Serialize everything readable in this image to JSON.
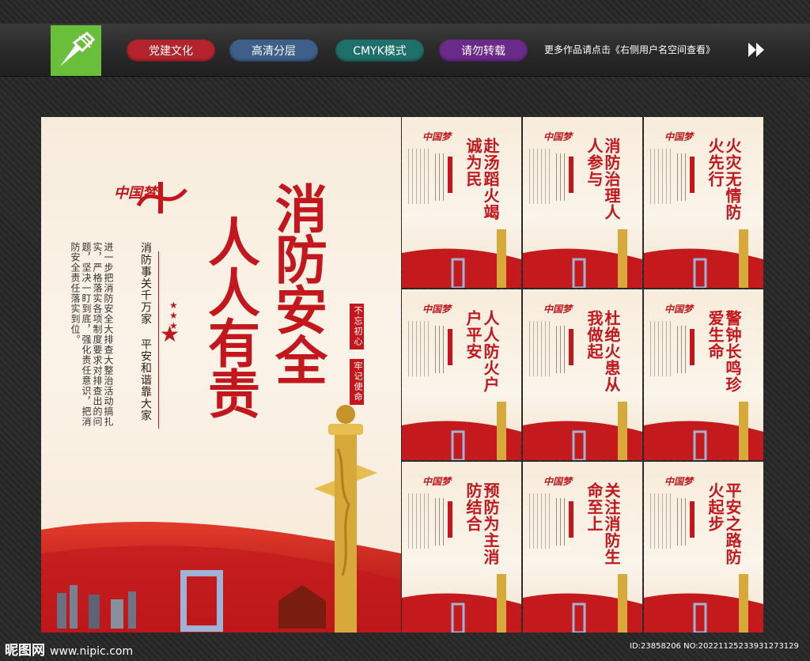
{
  "header": {
    "tags": [
      {
        "label": "党建文化",
        "color": "#b3242c"
      },
      {
        "label": "高清分层",
        "color": "#3e5f8a"
      },
      {
        "label": "CMYK模式",
        "color": "#1f6f6a"
      },
      {
        "label": "请勿转载",
        "color": "#6a2a8a"
      }
    ],
    "more_text": "更多作品请点击《右侧用户名空间查看》"
  },
  "main_poster": {
    "logo_text": "中国梦",
    "title_line1": "消防安全",
    "title_line2": "人人有责",
    "subtitle": "消防事关千万家 平安和谐靠大家",
    "body": "进一步把消防安全大排查大整治活动搞扎实，严格落实各项制度要求对排查出的问题，坚决一盯到底，强化责任意识，把消防安全责任落实到位。",
    "seal_1": "不忘初心",
    "seal_2": "牢记使命"
  },
  "cards": [
    {
      "title": "赴汤蹈火竭诚为民"
    },
    {
      "title": "消防治理人人参与"
    },
    {
      "title": "火灾无情防火先行"
    },
    {
      "title": "人人防火户户平安"
    },
    {
      "title": "杜绝火患从我做起"
    },
    {
      "title": "警钟长鸣珍爱生命"
    },
    {
      "title": "预防为主消防结合"
    },
    {
      "title": "关注消防生命至上"
    },
    {
      "title": "平安之路防火起步"
    }
  ],
  "footer": {
    "site_name": "昵图网",
    "site_url": "www.nipic.com",
    "id_text": "ID:23858206 NO:20221125233931273129"
  },
  "colors": {
    "accent": "#c3171d",
    "background": "#2b2b2b",
    "logo_green": "#6abf3a"
  }
}
